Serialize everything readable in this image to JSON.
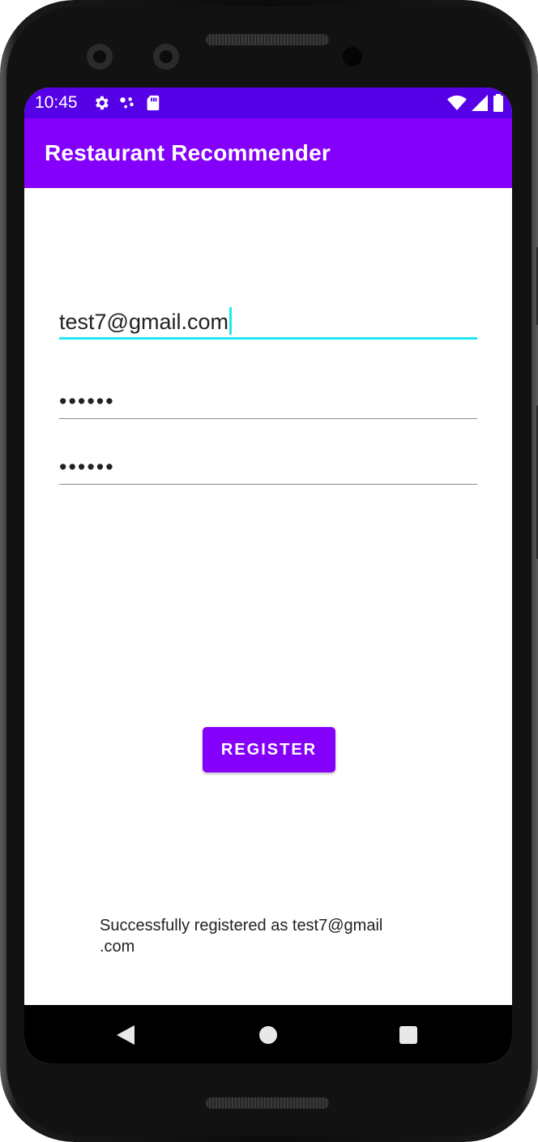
{
  "status_bar": {
    "time": "10:45",
    "icons_left": [
      "settings-gear-icon",
      "assistant-dots-icon",
      "sd-card-icon"
    ],
    "icons_right": [
      "wifi-icon",
      "cell-signal-icon",
      "battery-icon"
    ],
    "color": "#5600e8"
  },
  "app_bar": {
    "title": "Restaurant Recommender",
    "color": "#8400fb"
  },
  "form": {
    "email_value": "test7@gmail.com",
    "password_value": "••••••",
    "confirm_password_value": "••••••",
    "focus_color": "#1ee8f0"
  },
  "register_button": {
    "label": "REGISTER",
    "color": "#8400fb"
  },
  "message": {
    "text": "Successfully registered as test7@gmail\n.com"
  },
  "nav_bar": {
    "icons": [
      "back-icon",
      "home-icon",
      "recents-icon"
    ]
  }
}
